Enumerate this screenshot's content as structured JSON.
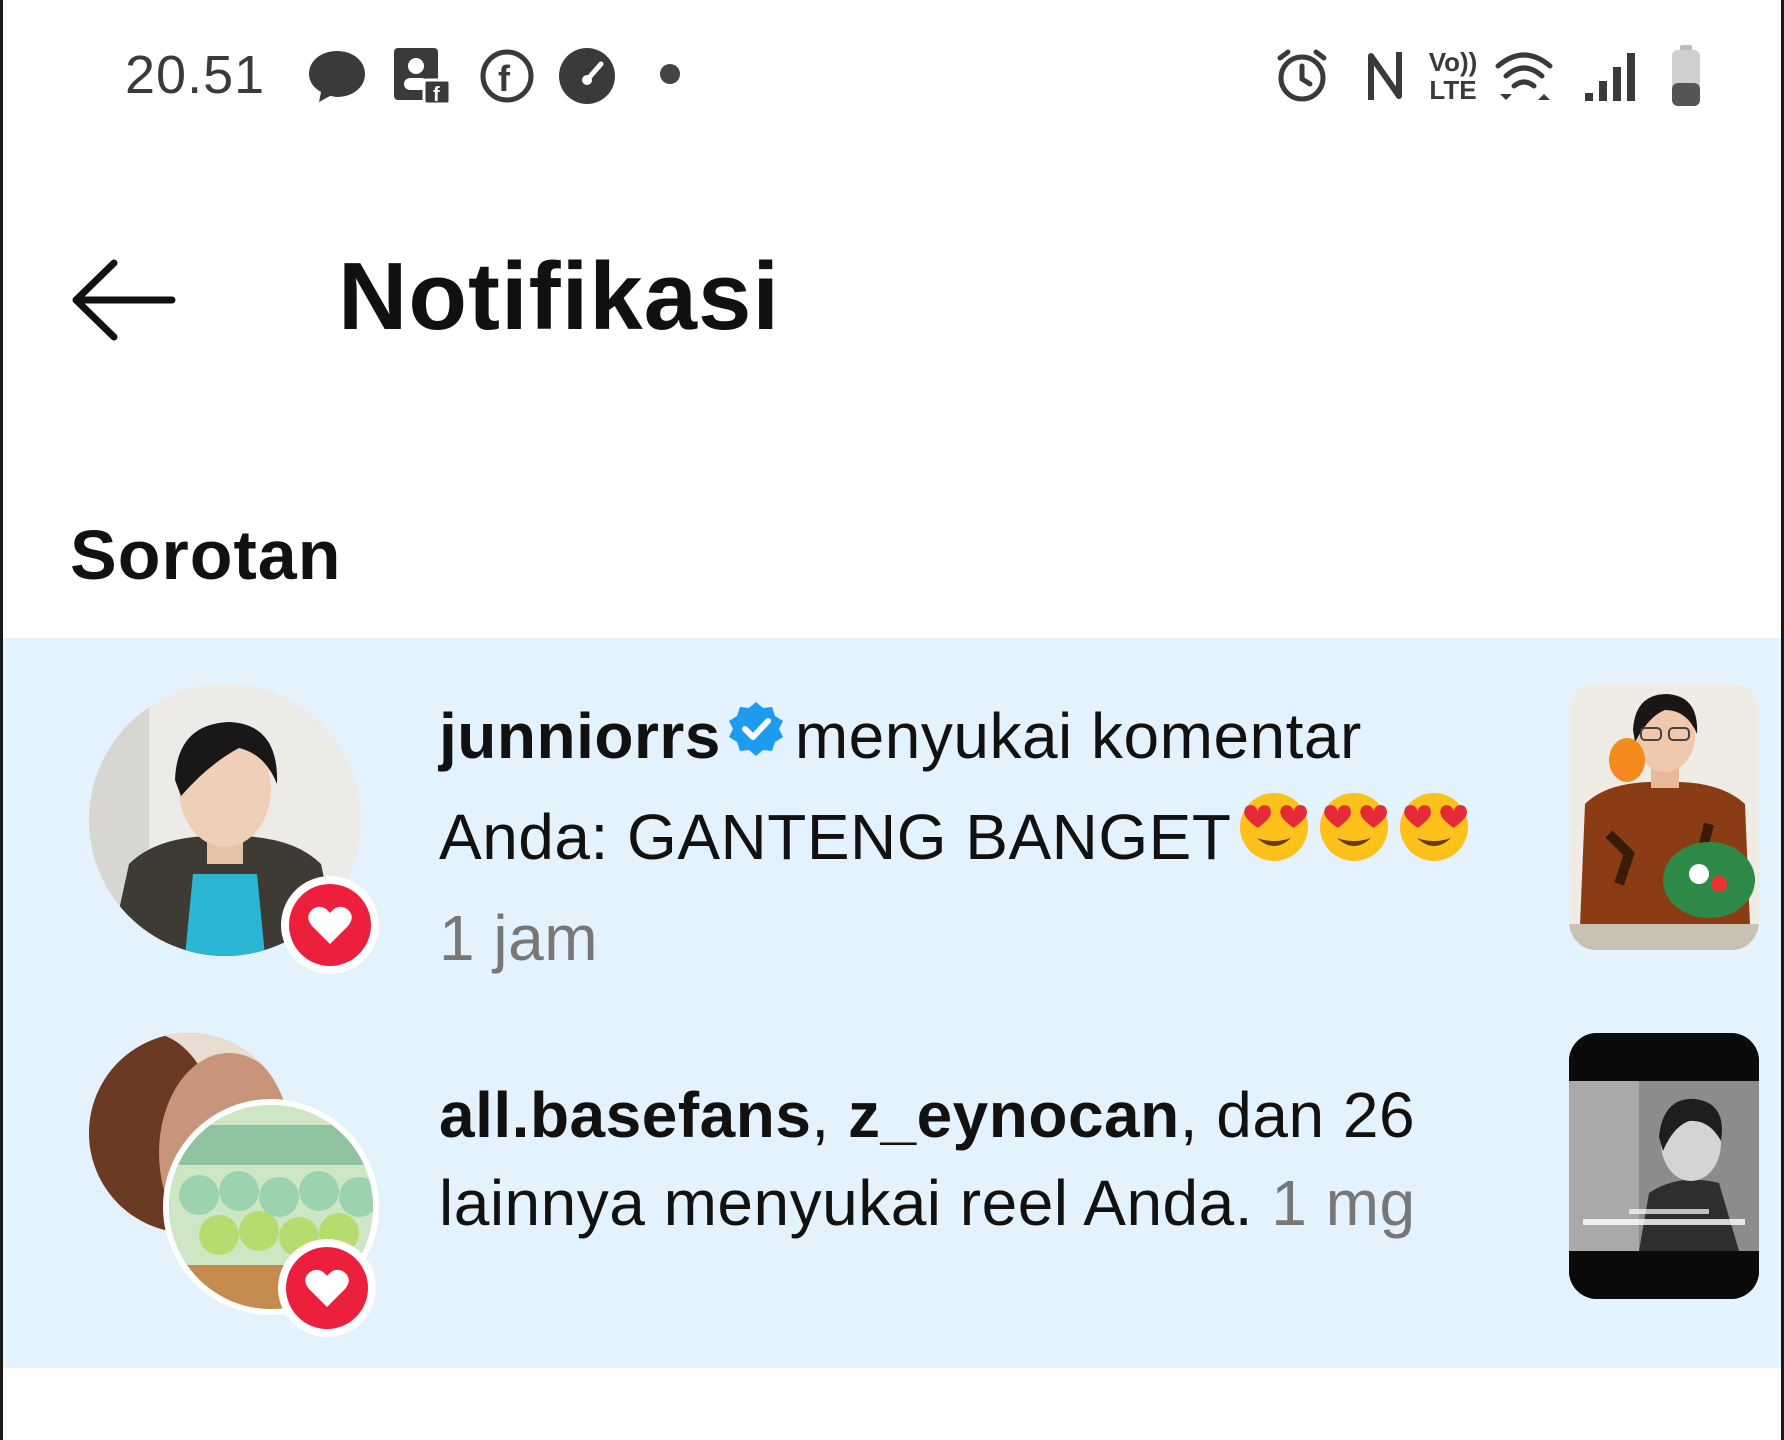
{
  "status_bar": {
    "time": "20.51",
    "left_icons": [
      "messenger-icon",
      "facebook-page-icon",
      "facebook-icon",
      "speedometer-icon"
    ],
    "right_icons": [
      "alarm-icon",
      "nfc-icon",
      "volte-icon",
      "wifi-icon",
      "signal-icon",
      "battery-icon"
    ],
    "volte_top": "Vo))",
    "volte_bottom": "LTE"
  },
  "header": {
    "title": "Notifikasi",
    "back_icon": "arrow-left-icon"
  },
  "section": {
    "title": "Sorotan"
  },
  "notifications": [
    {
      "username": "junniorrs",
      "verified": true,
      "action": "menyukai komentar",
      "comment_prefix": "Anda: ",
      "comment": "GANTENG BANGET",
      "emoji": [
        "heart-eyes-emoji",
        "heart-eyes-emoji",
        "heart-eyes-emoji"
      ],
      "time": "1 jam",
      "badge_icon": "heart-icon"
    },
    {
      "user1": "all.basefans",
      "sep": ", ",
      "user2": "z_eynocan",
      "rest_line1": ", dan 26",
      "line2": "lainnya menyukai reel Anda.",
      "time": "1 mg",
      "badge_icon": "heart-icon"
    }
  ],
  "colors": {
    "highlight_bg": "#e3f2fc",
    "heart_red": "#ec1f3d",
    "verified_blue": "#1d9bf0",
    "muted_text": "#777777"
  }
}
